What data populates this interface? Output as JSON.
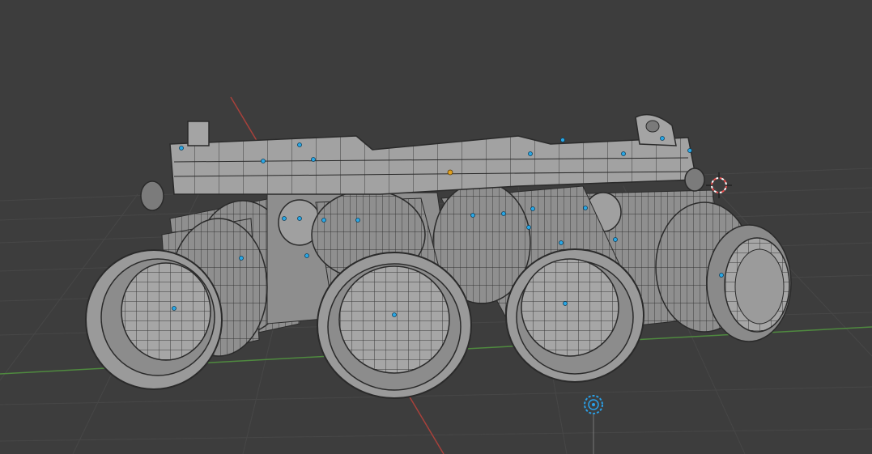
{
  "viewport": {
    "background": "#3d3d3d",
    "grid_color": "#4a4a4a",
    "axis_x_color": "#a8413b",
    "axis_y_color": "#4f8a3f",
    "mesh_fill": "#9a9a9a",
    "mesh_shade": "#7b7b7b",
    "wire_color": "#2a2a2a",
    "origin_dot_color": "#29a7e6",
    "active_origin_color": "#e0a020",
    "cursor_color": "#e85050",
    "light_icon_color": "#2aa0e8"
  },
  "icons": {
    "cursor": "3d-cursor-icon",
    "light": "light-object-icon"
  }
}
